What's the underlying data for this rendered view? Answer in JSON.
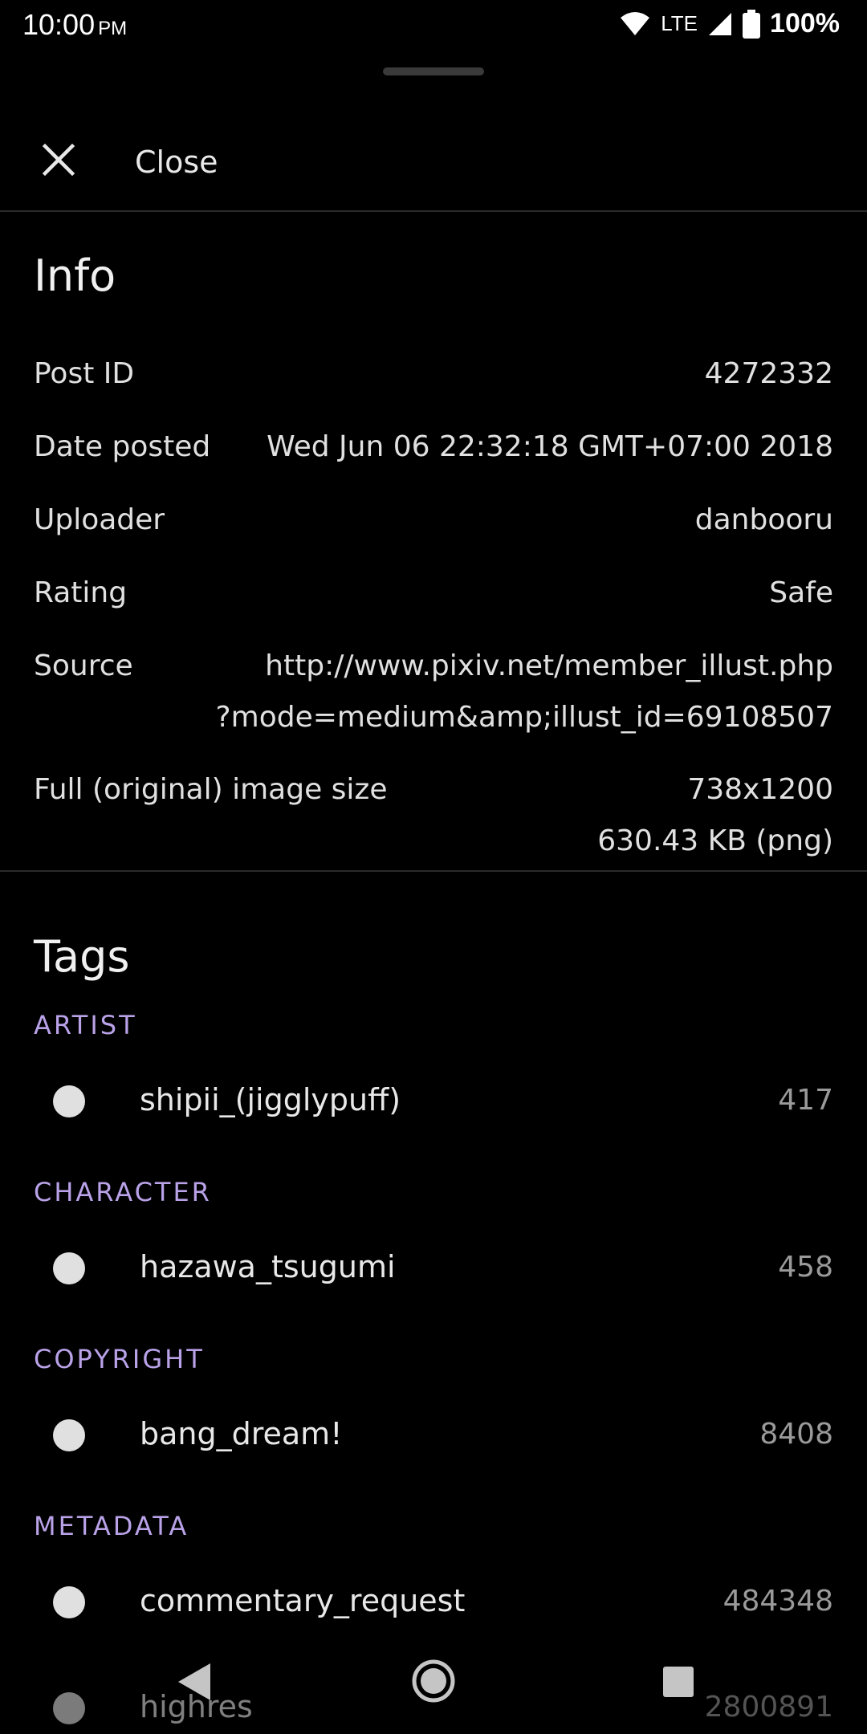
{
  "status": {
    "time": "10:00",
    "ampm": "PM",
    "network": "LTE",
    "battery": "100%"
  },
  "header": {
    "close_label": "Close"
  },
  "info": {
    "title": "Info",
    "post_id_label": "Post ID",
    "post_id": "4272332",
    "date_label": "Date posted",
    "date": "Wed Jun 06 22:32:18 GMT+07:00 2018",
    "uploader_label": "Uploader",
    "uploader": "danbooru",
    "rating_label": "Rating",
    "rating": "Safe",
    "source_label": "Source",
    "source_line1": "http://www.pixiv.net/member_illust.php",
    "source_line2": "?mode=medium&amp;illust_id=69108507",
    "size_label": "Full (original) image size",
    "size_dims": "738x1200",
    "size_file": "630.43 KB (png)"
  },
  "tags": {
    "title": "Tags",
    "groups": [
      {
        "category": "ARTIST",
        "name": "shipii_(jigglypuff)",
        "count": "417"
      },
      {
        "category": "CHARACTER",
        "name": "hazawa_tsugumi",
        "count": "458"
      },
      {
        "category": "COPYRIGHT",
        "name": "bang_dream!",
        "count": "8408"
      },
      {
        "category": "METADATA",
        "name": "commentary_request",
        "count": "484348"
      }
    ],
    "extra": {
      "name": "highres",
      "count": "2800891"
    }
  },
  "colors": {
    "background": "#000000",
    "category_accent": "#b9a2e8",
    "divider": "#2a2a2a"
  }
}
